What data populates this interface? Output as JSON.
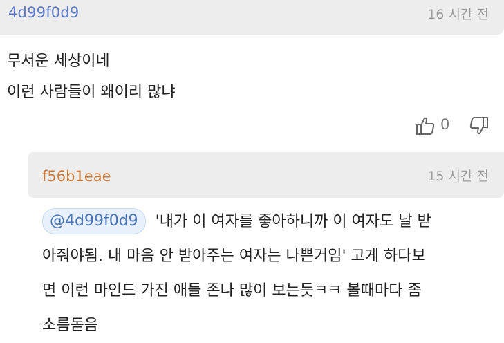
{
  "comment1": {
    "username": "4d99f0d9",
    "time": "16 시간 전",
    "lines": [
      "무서운 세상이네",
      "이런 사람들이 왜이리 많냐"
    ],
    "likes": "0"
  },
  "reply1": {
    "username": "f56b1eae",
    "time": "15 시간 전",
    "mention": "@4d99f0d9",
    "lines": [
      "'내가 이 여자를 좋아하니까 이 여자도 날 받",
      "아줘야됨. 내 마음 안 받아주는 여자는 나쁜거임' 고게 하다보",
      "면 이런 마인드 가진 애들 존나 많이 보는듯ㅋㅋ 볼때마다 좀",
      "소름돋음"
    ]
  },
  "colors": {
    "header_bg": "#ededed",
    "username_blue": "#5b79c6",
    "username_orange": "#cc7a3a",
    "mention_blue": "#4a74b8"
  },
  "icons": {
    "like": "thumbs-up-icon",
    "dislike": "thumbs-down-icon"
  }
}
